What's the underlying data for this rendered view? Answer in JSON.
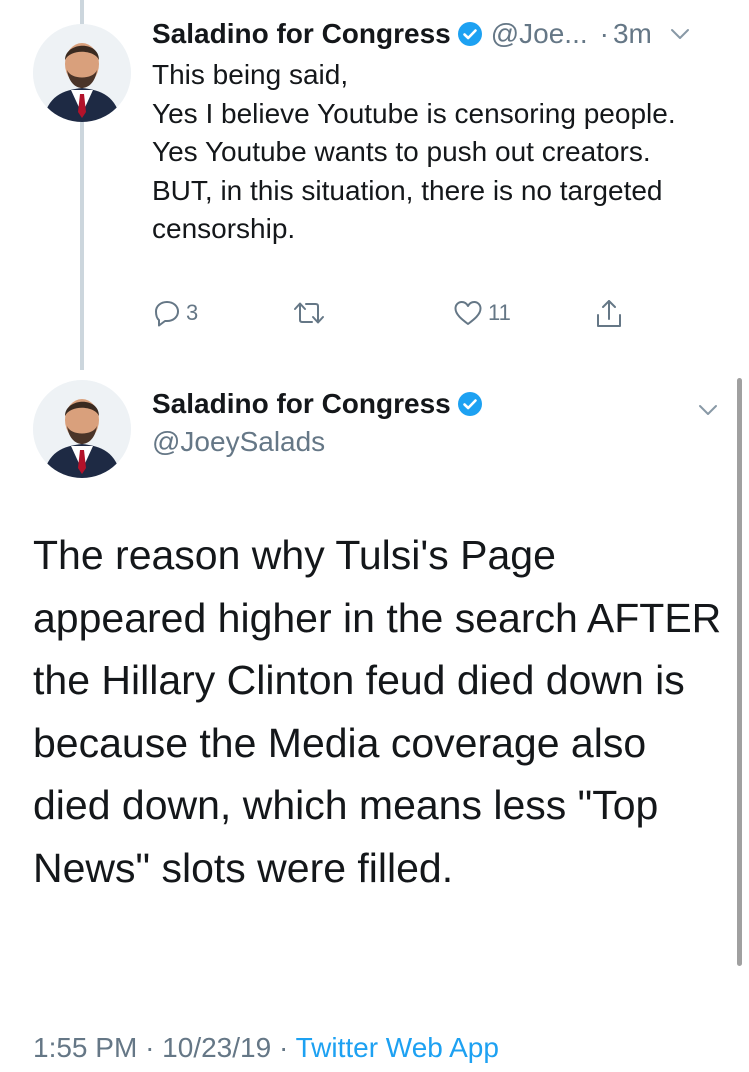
{
  "tweet_1": {
    "author_name": "Saladino for Congress",
    "handle": "@Joe...",
    "separator": "·",
    "time": "3m",
    "text": "This being said,\nYes I believe Youtube is censoring people.\nYes Youtube wants to push out creators.\nBUT, in this situation, there is no targeted censorship.",
    "reply_count": "3",
    "retweet_count": "",
    "like_count": "11"
  },
  "tweet_2": {
    "author_name": "Saladino for Congress",
    "handle": "@JoeySalads",
    "text": "The reason why Tulsi's Page appeared higher in the search AFTER the Hillary Clinton feud died down is because the Media coverage also died down, which means less \"Top News\" slots were filled.",
    "time": "1:55 PM",
    "sep_1": "·",
    "date": "10/23/19",
    "sep_2": "·",
    "source": "Twitter Web App"
  },
  "colors": {
    "accent": "#1da1f2",
    "secondary_text": "#657786",
    "primary_text": "#14171a",
    "thread_line": "#ccd6dd"
  },
  "icons": {
    "verified": "verified-badge-icon",
    "chevron": "chevron-down-icon",
    "reply": "reply-icon",
    "retweet": "retweet-icon",
    "like": "heart-icon",
    "share": "share-icon"
  }
}
